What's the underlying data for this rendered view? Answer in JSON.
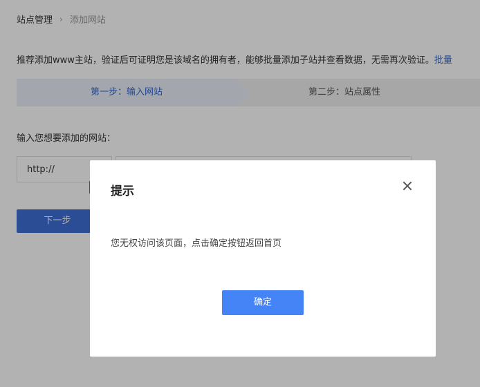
{
  "breadcrumb": {
    "root": "站点管理",
    "separator": "›",
    "current": "添加网站"
  },
  "intro": {
    "text": "推荐添加www主站，验证后可证明您是该域名的拥有者，能够批量添加子站并查看数据，无需再次验证。",
    "link": "批量"
  },
  "steps": [
    {
      "label": "第一步：输入网站",
      "active": true
    },
    {
      "label": "第二步：站点属性",
      "active": false
    }
  ],
  "form": {
    "field_label": "输入您想要添加的网站：",
    "protocol": "http://",
    "url_value": "",
    "next_label": "下一步"
  },
  "modal": {
    "title": "提示",
    "message": "您无权访问该页面，点击确定按钮返回首页",
    "confirm_label": "确定"
  },
  "colors": {
    "accent": "#3468ce",
    "primary_button": "#4584f7",
    "step_active_bg": "#eaeef8",
    "overlay": "rgba(0,0,0,0.3)"
  }
}
